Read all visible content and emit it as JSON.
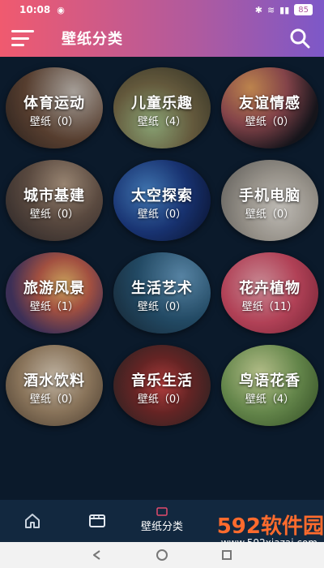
{
  "status": {
    "time": "10:08",
    "battery": "85"
  },
  "header": {
    "title": "壁纸分类"
  },
  "categories": [
    {
      "name": "体育运动",
      "count": "壁纸（0）"
    },
    {
      "name": "儿童乐趣",
      "count": "壁纸（4）"
    },
    {
      "name": "友谊情感",
      "count": "壁纸（0）"
    },
    {
      "name": "城市基建",
      "count": "壁纸（0）"
    },
    {
      "name": "太空探索",
      "count": "壁纸（0）"
    },
    {
      "name": "手机电脑",
      "count": "壁纸（0）"
    },
    {
      "name": "旅游风景",
      "count": "壁纸（1）"
    },
    {
      "name": "生活艺术",
      "count": "壁纸（0）"
    },
    {
      "name": "花卉植物",
      "count": "壁纸（11）"
    },
    {
      "name": "酒水饮料",
      "count": "壁纸（0）"
    },
    {
      "name": "音乐生活",
      "count": "壁纸（0）"
    },
    {
      "name": "鸟语花香",
      "count": "壁纸（4）"
    }
  ],
  "bottom_nav": {
    "active_label": "壁纸分类"
  },
  "watermark": {
    "brand": "592软件园",
    "url": "www.592xiazai.com"
  },
  "colors": {
    "header_start": "#f05a6f",
    "header_end": "#7d58c8",
    "background": "#0b1a2b",
    "nav_bg": "#12283f",
    "brand": "#ff6b2d"
  }
}
